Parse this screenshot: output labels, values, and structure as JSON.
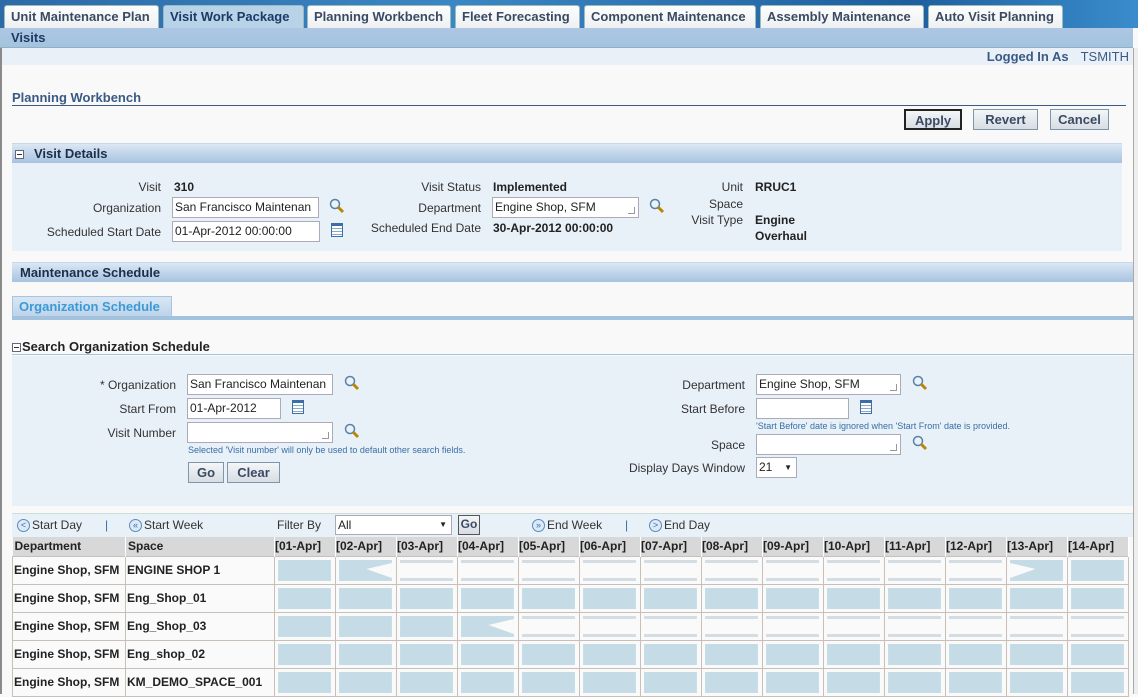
{
  "tabs": [
    {
      "label": "Unit Maintenance Plan",
      "active": false
    },
    {
      "label": "Visit Work Package",
      "active": true
    },
    {
      "label": "Planning Workbench",
      "active": false
    },
    {
      "label": "Fleet Forecasting",
      "active": false
    },
    {
      "label": "Component Maintenance",
      "active": false
    },
    {
      "label": "Assembly Maintenance",
      "active": false
    },
    {
      "label": "Auto Visit Planning",
      "active": false
    }
  ],
  "subnav": "Visits",
  "login": {
    "label": "Logged In As",
    "user": "TSMITH"
  },
  "page_title": "Planning Workbench",
  "buttons": {
    "apply": "Apply",
    "revert": "Revert",
    "cancel": "Cancel"
  },
  "visit_details": {
    "title": "Visit Details",
    "visit_label": "Visit",
    "visit": "310",
    "org_label": "Organization",
    "org": "San Francisco Maintenan",
    "start_label": "Scheduled Start Date",
    "start": "01-Apr-2012 00:00:00",
    "status_label": "Visit Status",
    "status": "Implemented",
    "dept_label": "Department",
    "dept": "Engine Shop, SFM",
    "end_label": "Scheduled End Date",
    "end": "30-Apr-2012 00:00:00",
    "unit_label": "Unit",
    "unit": "RRUC1",
    "space_label": "Space",
    "type_label": "Visit Type",
    "type1": "Engine",
    "type2": "Overhaul"
  },
  "maintenance_schedule": {
    "title": "Maintenance Schedule",
    "tab": "Organization Schedule"
  },
  "search": {
    "title": "Search Organization Schedule",
    "org_label": "* Organization",
    "org": "San Francisco Maintenan",
    "start_from_label": "Start From",
    "start_from": "01-Apr-2012",
    "visit_number_label": "Visit Number",
    "visit_number": "",
    "visit_hint": "Selected 'Visit number' will only be used to default other search fields.",
    "go": "Go",
    "clear": "Clear",
    "dept_label": "Department",
    "dept": "Engine Shop, SFM",
    "start_before_label": "Start Before",
    "start_before": "",
    "start_before_hint": "'Start Before' date is ignored when 'Start From' date is provided.",
    "space_label": "Space",
    "space": "",
    "days_label": "Display Days Window",
    "days": "21"
  },
  "toolbar": {
    "start_day": "Start Day",
    "start_week": "Start Week",
    "filter_label": "Filter By",
    "filter": "All",
    "go": "Go",
    "end_week": "End Week",
    "end_day": "End Day",
    "sep": "|"
  },
  "grid": {
    "headers": [
      "Department",
      "Space"
    ],
    "dates": [
      "[01-Apr]",
      "[02-Apr]",
      "[03-Apr]",
      "[04-Apr]",
      "[05-Apr]",
      "[06-Apr]",
      "[07-Apr]",
      "[08-Apr]",
      "[09-Apr]",
      "[10-Apr]",
      "[11-Apr]",
      "[12-Apr]",
      "[13-Apr]",
      "[14-Apr]"
    ],
    "rows": [
      {
        "dept": "Engine Shop, SFM",
        "space": "ENGINE SHOP 1",
        "cells": [
          "free",
          "start",
          "busy",
          "busy",
          "busy",
          "busy",
          "busy",
          "busy",
          "busy",
          "busy",
          "busy",
          "busy",
          "end",
          "free"
        ]
      },
      {
        "dept": "Engine Shop, SFM",
        "space": "Eng_Shop_01",
        "cells": [
          "free",
          "free",
          "free",
          "free",
          "free",
          "free",
          "free",
          "free",
          "free",
          "free",
          "free",
          "free",
          "free",
          "free"
        ]
      },
      {
        "dept": "Engine Shop, SFM",
        "space": "Eng_Shop_03",
        "cells": [
          "free",
          "free",
          "free",
          "start",
          "busy",
          "busy",
          "busy",
          "busy",
          "busy",
          "busy",
          "busy",
          "busy",
          "busy",
          "busy"
        ]
      },
      {
        "dept": "Engine Shop, SFM",
        "space": "Eng_shop_02",
        "cells": [
          "free",
          "free",
          "free",
          "free",
          "free",
          "free",
          "free",
          "free",
          "free",
          "free",
          "free",
          "free",
          "free",
          "free"
        ]
      },
      {
        "dept": "Engine Shop, SFM",
        "space": "KM_DEMO_SPACE_001",
        "cells": [
          "free",
          "free",
          "free",
          "free",
          "free",
          "free",
          "free",
          "free",
          "free",
          "free",
          "free",
          "free",
          "free",
          "free"
        ]
      }
    ]
  },
  "colors": {
    "free": "#c5dce6",
    "busy_line": "#d3dde3",
    "accent": "#3a5a85"
  }
}
